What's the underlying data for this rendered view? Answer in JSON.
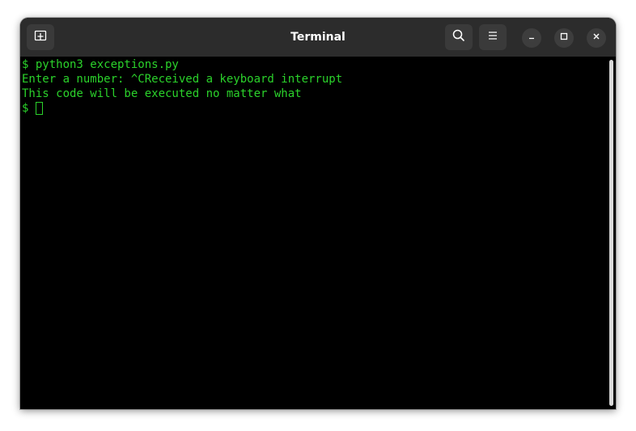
{
  "window": {
    "title": "Terminal"
  },
  "toolbar": {
    "new_tab_icon": "new-tab-icon",
    "search_icon": "search-icon",
    "menu_icon": "hamburger-menu-icon",
    "minimize_icon": "minimize-icon",
    "maximize_icon": "maximize-icon",
    "close_icon": "close-icon"
  },
  "terminal": {
    "lines": [
      "$ python3 exceptions.py",
      "Enter a number: ^CReceived a keyboard interrupt",
      "This code will be executed no matter what",
      "$"
    ],
    "text_color": "#2bd22b",
    "background_color": "#000000"
  }
}
